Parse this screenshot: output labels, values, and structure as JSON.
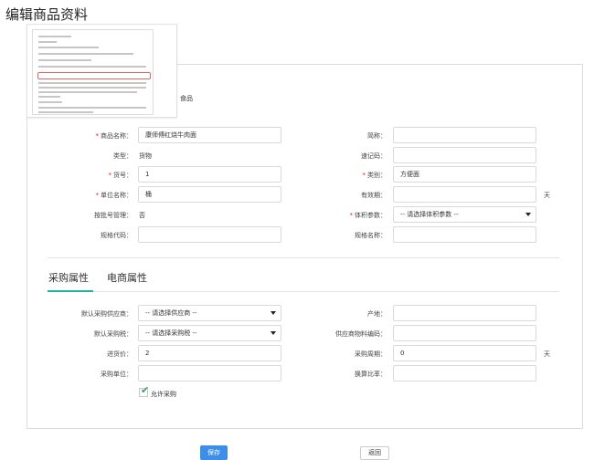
{
  "page": {
    "title": "编辑商品资料"
  },
  "thumbnail": {
    "category": "食品"
  },
  "basic": {
    "product_name": {
      "label": "商品名称：",
      "value": "康师傅红烧牛肉面"
    },
    "short_name": {
      "label": "简称：",
      "value": ""
    },
    "type": {
      "label": "类型：",
      "value": "货物"
    },
    "quick_code": {
      "label": "速记码：",
      "value": ""
    },
    "item_no": {
      "label": "货号：",
      "value": "1"
    },
    "category": {
      "label": "类别：",
      "value": "方便面"
    },
    "unit_name": {
      "label": "单位名称：",
      "value": "桶"
    },
    "validity": {
      "label": "有效期：",
      "value": "",
      "unit": "天"
    },
    "batch_mgmt": {
      "label": "按批号管理：",
      "value": "否"
    },
    "volume_param": {
      "label": "体积参数：",
      "value": "-- 请选择体积参数 --"
    },
    "spec_code": {
      "label": "规格代码：",
      "value": ""
    },
    "spec_name": {
      "label": "规格名称：",
      "value": ""
    }
  },
  "tabs": [
    {
      "label": "采购属性",
      "active": true
    },
    {
      "label": "电商属性",
      "active": false
    }
  ],
  "purchase": {
    "default_supplier": {
      "label": "默认采购供应商：",
      "value": "-- 请选择供应商 --"
    },
    "origin": {
      "label": "产地：",
      "value": ""
    },
    "default_tax": {
      "label": "默认采购税：",
      "value": "-- 请选择采购税 --"
    },
    "supplier_code": {
      "label": "供应商物料编码：",
      "value": ""
    },
    "purchase_price": {
      "label": "进货价：",
      "value": "2"
    },
    "purchase_cycle": {
      "label": "采购周期：",
      "value": "0",
      "unit": "天"
    },
    "purchase_unit": {
      "label": "采购单位：",
      "value": ""
    },
    "conversion_ratio": {
      "label": "换算比率：",
      "value": ""
    },
    "allow_purchase": {
      "label": "允许采购",
      "checked": true
    }
  },
  "buttons": {
    "save": "保存",
    "back": "返回"
  },
  "colors": {
    "accent": "#21b3a1",
    "primary_button": "#3d8ee8",
    "required": "#e02020",
    "check": "#2fa84f"
  }
}
